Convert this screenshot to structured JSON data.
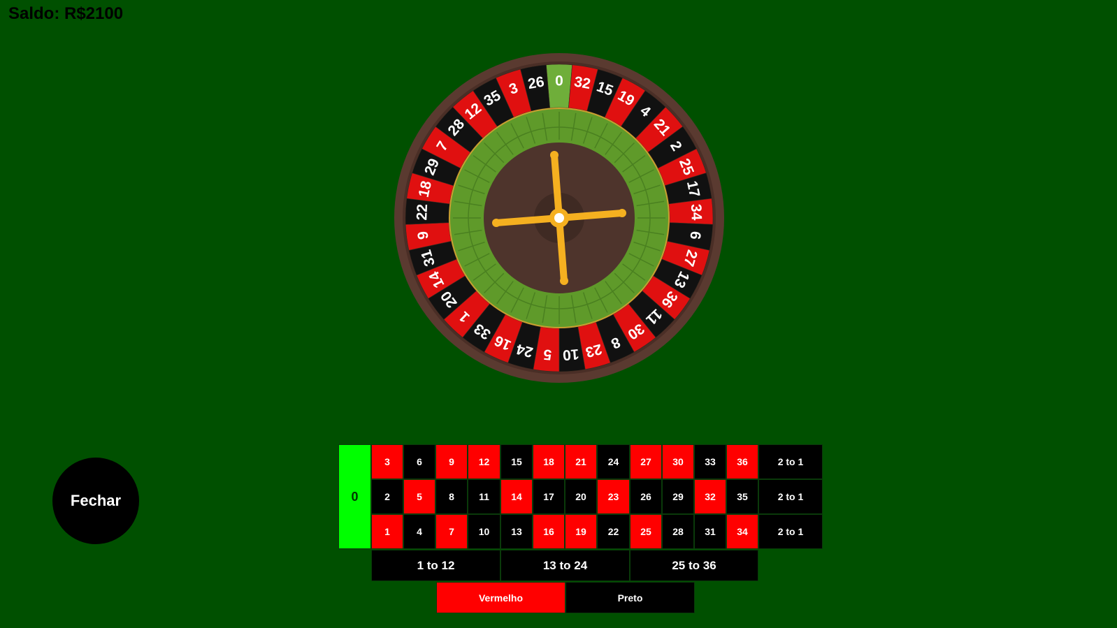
{
  "balance_label": "Saldo: R$2100",
  "close_button": "Fechar",
  "colors": {
    "felt": "#005000",
    "red": "#ff0000",
    "black": "#000000",
    "green": "#00ff00",
    "wood": "#5a3a30",
    "turret": "#f5b020"
  },
  "wheel": {
    "sequence": [
      "0",
      "32",
      "15",
      "19",
      "4",
      "21",
      "2",
      "25",
      "17",
      "34",
      "6",
      "27",
      "13",
      "36",
      "11",
      "30",
      "8",
      "23",
      "10",
      "5",
      "24",
      "16",
      "33",
      "1",
      "20",
      "14",
      "31",
      "9",
      "22",
      "18",
      "29",
      "7",
      "28",
      "12",
      "35",
      "3",
      "26"
    ],
    "red_numbers": [
      "32",
      "19",
      "21",
      "25",
      "34",
      "27",
      "36",
      "30",
      "23",
      "5",
      "16",
      "1",
      "14",
      "9",
      "18",
      "7",
      "12",
      "3"
    ]
  },
  "board": {
    "zero": "0",
    "rows": [
      [
        "3",
        "6",
        "9",
        "12",
        "15",
        "18",
        "21",
        "24",
        "27",
        "30",
        "33",
        "36"
      ],
      [
        "2",
        "5",
        "8",
        "11",
        "14",
        "17",
        "20",
        "23",
        "26",
        "29",
        "32",
        "35"
      ],
      [
        "1",
        "4",
        "7",
        "10",
        "13",
        "16",
        "19",
        "22",
        "25",
        "28",
        "31",
        "34"
      ]
    ],
    "column_bets": [
      "2 to 1",
      "2 to 1",
      "2 to 1"
    ],
    "dozens": [
      "1 to 12",
      "13 to 24",
      "25 to 36"
    ],
    "color_bets": [
      "Vermelho",
      "Preto"
    ]
  }
}
